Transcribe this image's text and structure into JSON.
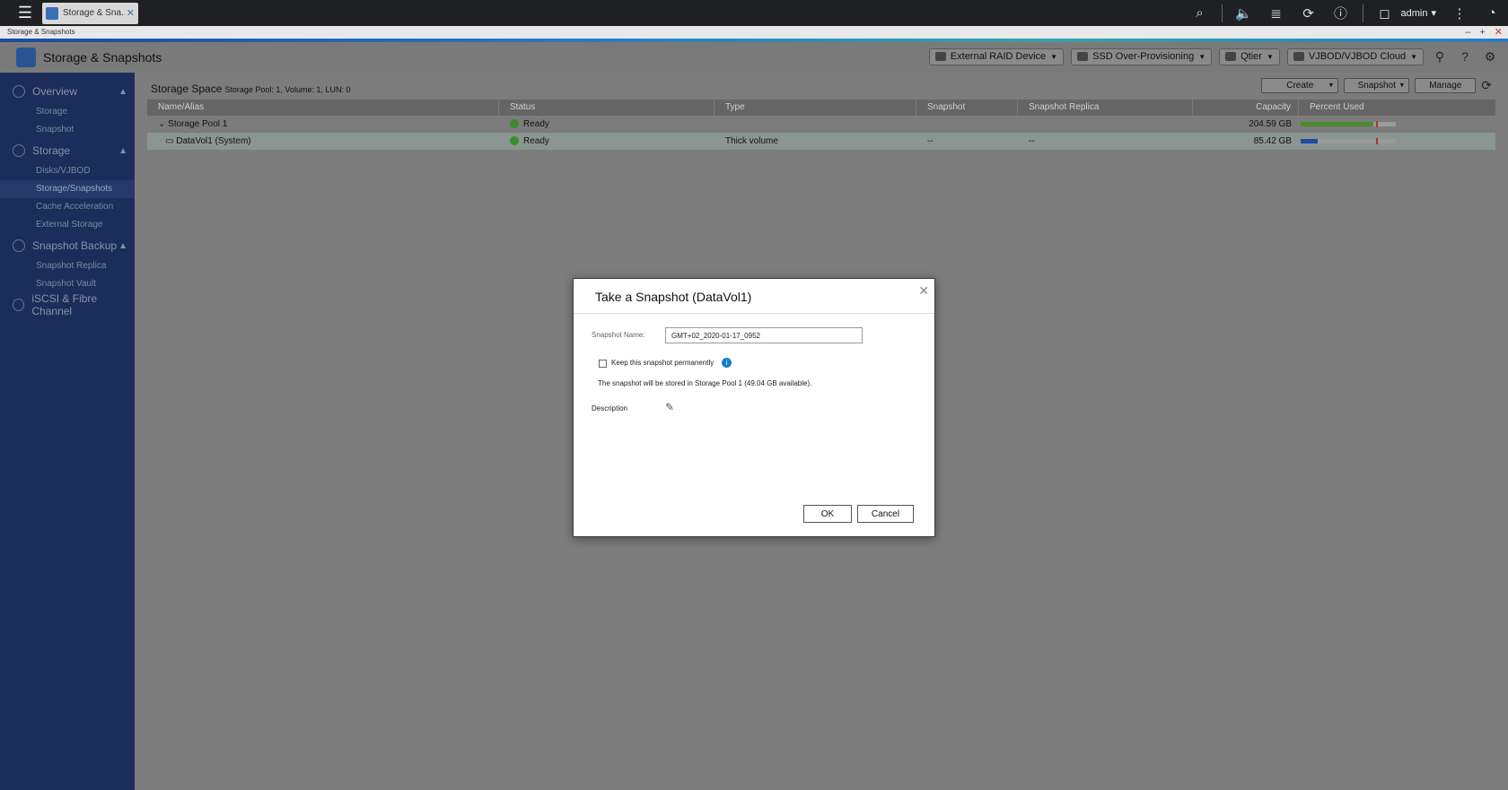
{
  "taskbar": {
    "tab_label": "Storage & Sna...",
    "user": "admin"
  },
  "window": {
    "strip_title": "Storage & Snapshots"
  },
  "app": {
    "title": "Storage & Snapshots",
    "header_buttons": {
      "external_raid": "External RAID Device",
      "ssd_overprov": "SSD Over-Provisioning",
      "qtier": "Qtier",
      "vjbod": "VJBOD/VJBOD Cloud"
    }
  },
  "sidebar": {
    "overview": "Overview",
    "overview_items": [
      "Storage",
      "Snapshot"
    ],
    "storage": "Storage",
    "storage_items": [
      "Disks/VJBOD",
      "Storage/Snapshots",
      "Cache Acceleration",
      "External Storage"
    ],
    "snapshot_backup": "Snapshot Backup",
    "snapshot_items": [
      "Snapshot Replica",
      "Snapshot Vault"
    ],
    "iscsi": "iSCSI & Fibre Channel"
  },
  "main": {
    "space_title": "Storage Space",
    "space_summary": "Storage Pool: 1, Volume: 1, LUN: 0",
    "actions": {
      "create": "Create",
      "snapshot": "Snapshot",
      "manage": "Manage"
    },
    "columns": [
      "Name/Alias",
      "Status",
      "Type",
      "Snapshot",
      "Snapshot Replica",
      "Capacity",
      "Percent Used"
    ],
    "rows": [
      {
        "name": "Storage Pool 1",
        "status": "Ready",
        "type": "",
        "snapshot": "",
        "replica": "",
        "capacity": "204.59 GB",
        "used_pct": 0.76
      },
      {
        "name": "DataVol1 (System)",
        "status": "Ready",
        "type": "Thick volume",
        "snapshot": "--",
        "replica": "--",
        "capacity": "85.42 GB",
        "used_pct": 0.18
      }
    ]
  },
  "modal": {
    "title": "Take a Snapshot (DataVol1)",
    "name_label": "Snapshot Name:",
    "name_value": "GMT+02_2020-01-17_0952",
    "keep_label": "Keep this snapshot permanently",
    "note": "The snapshot will be stored in Storage Pool 1 (49.04 GB available).",
    "description_label": "Description",
    "ok": "OK",
    "cancel": "Cancel"
  },
  "colors": {
    "sidebar_bg": "#1b2d5a",
    "accent": "#2b7bc4",
    "status_ok": "#3c8c2a",
    "pool_bar": "#4a8a2a",
    "vol_bar": "#1e4aa0"
  }
}
